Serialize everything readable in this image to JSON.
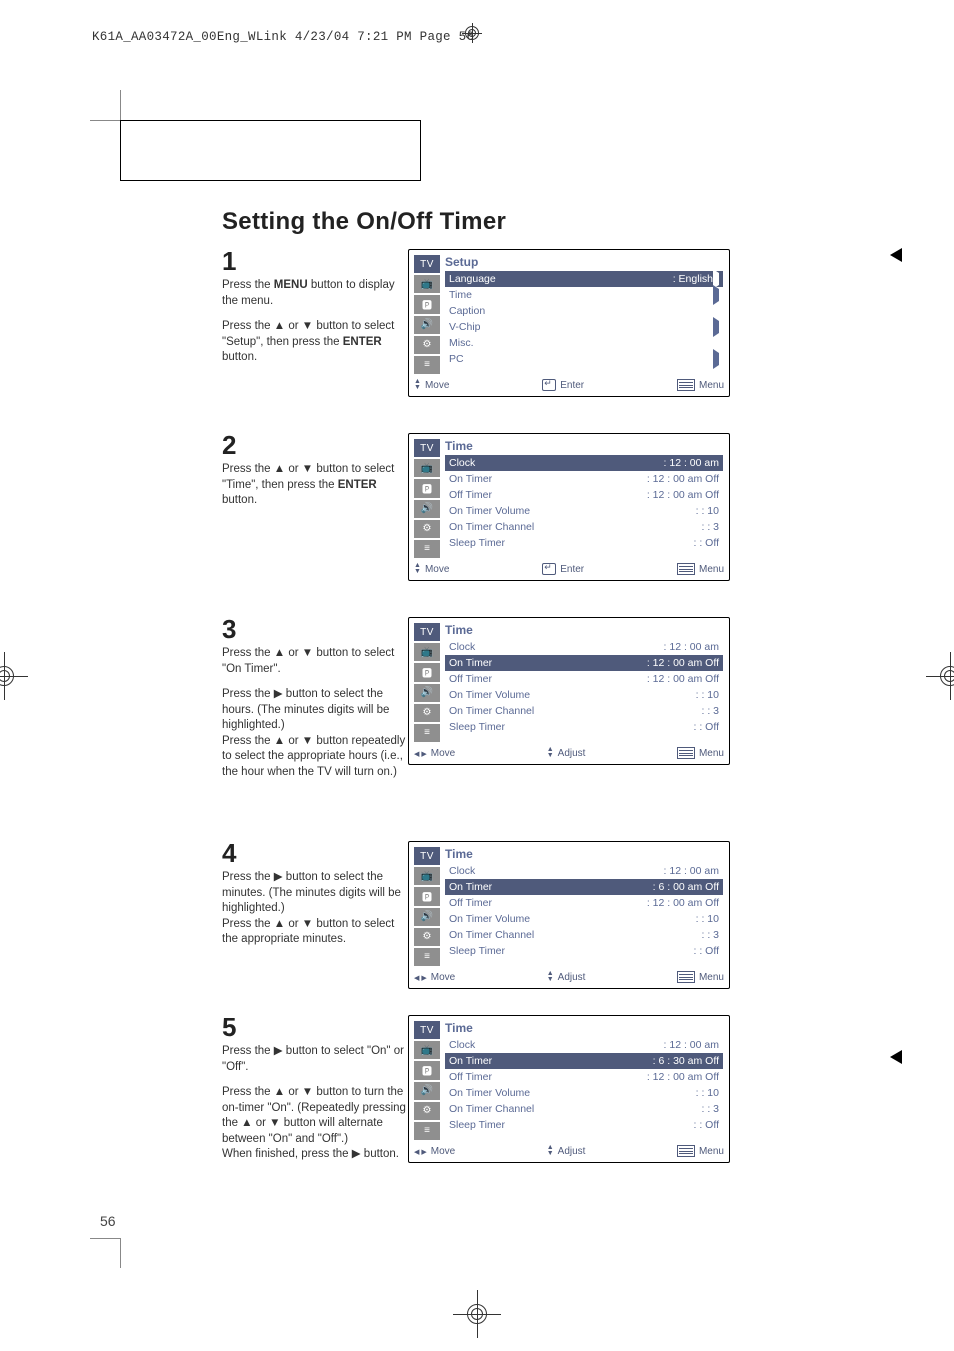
{
  "slug": "K61A_AA03472A_00Eng_WLink  4/23/04  7:21 PM  Page 56",
  "section_title": "Setting the On/Off Timer",
  "page_number": "56",
  "glyph": {
    "up": "▲",
    "down": "▼",
    "right": "▶"
  },
  "steps": [
    {
      "num": "1",
      "paras": [
        "Press the <b>MENU</b> button to display the menu.",
        "Press the ▲ or ▼ button to select \"Setup\", then press the <b>ENTER</b> button."
      ]
    },
    {
      "num": "2",
      "paras": [
        "Press the ▲ or ▼ button to select \"Time\", then press the <b>ENTER</b> button."
      ]
    },
    {
      "num": "3",
      "paras": [
        "Press the ▲ or ▼ button to select \"On Timer\".",
        "Press the ▶ button to select the hours. (The minutes digits will be highlighted.)<br>Press the ▲ or ▼ button repeatedly to select the appropriate hours (i.e., the hour when the TV will turn on.)"
      ]
    },
    {
      "num": "4",
      "paras": [
        "Press the ▶ button to select the minutes. (The minutes digits will be highlighted.)<br>Press the ▲ or ▼ button to select the appropriate minutes."
      ]
    },
    {
      "num": "5",
      "paras": [
        "Press the ▶ button to select \"On\" or \"Off\".",
        "Press the ▲ or ▼ button to turn the on-timer \"On\". (Repeatedly pressing the ▲ or ▼ button will alternate between \"On\" and \"Off\".)<br>When finished, press the ▶ button."
      ]
    }
  ],
  "osd_icons_label": "TV",
  "osd": [
    {
      "title": "Setup",
      "rows": [
        {
          "label": "Language",
          "value": "English",
          "sel": true,
          "arrow": true,
          "arrowOnLeft": true
        },
        {
          "label": "Time",
          "value": "",
          "sel": false,
          "arrow": true
        },
        {
          "label": "Caption",
          "value": "",
          "sel": false,
          "arrow": false
        },
        {
          "label": "V-Chip",
          "value": "",
          "sel": false,
          "arrow": true
        },
        {
          "label": "Misc.",
          "value": "",
          "sel": false,
          "arrow": false
        },
        {
          "label": "PC",
          "value": "",
          "sel": false,
          "arrow": true
        }
      ],
      "footer": {
        "left": "Move",
        "mid": "Enter",
        "right": "Menu",
        "nav": "updown"
      }
    },
    {
      "title": "Time",
      "rows": [
        {
          "label": "Clock",
          "value": "12 : 00 am",
          "sel": true
        },
        {
          "label": "On Timer",
          "value": "12 : 00 am Off"
        },
        {
          "label": "Off Timer",
          "value": "12 : 00 am Off"
        },
        {
          "label": "On Timer Volume",
          "value": ": 10"
        },
        {
          "label": "On Timer Channel",
          "value": ":   3"
        },
        {
          "label": "Sleep Timer",
          "value": ": Off"
        }
      ],
      "footer": {
        "left": "Move",
        "mid": "Enter",
        "right": "Menu",
        "nav": "updown"
      }
    },
    {
      "title": "Time",
      "rows": [
        {
          "label": "Clock",
          "value": "12 : 00 am"
        },
        {
          "label": "On Timer",
          "value": "12 : 00 am Off",
          "sel": true
        },
        {
          "label": "Off Timer",
          "value": "12 : 00 am Off"
        },
        {
          "label": "On Timer Volume",
          "value": ": 10"
        },
        {
          "label": "On Timer Channel",
          "value": ":   3"
        },
        {
          "label": "Sleep Timer",
          "value": ": Off"
        }
      ],
      "footer": {
        "left": "Move",
        "mid": "Adjust",
        "right": "Menu",
        "nav": "lr"
      }
    },
    {
      "title": "Time",
      "rows": [
        {
          "label": "Clock",
          "value": "12 : 00 am"
        },
        {
          "label": "On Timer",
          "value": "6 : 00 am Off",
          "sel": true
        },
        {
          "label": "Off Timer",
          "value": "12 : 00 am Off"
        },
        {
          "label": "On Timer Volume",
          "value": ": 10"
        },
        {
          "label": "On Timer Channel",
          "value": ":   3"
        },
        {
          "label": "Sleep Timer",
          "value": ": Off"
        }
      ],
      "footer": {
        "left": "Move",
        "mid": "Adjust",
        "right": "Menu",
        "nav": "lr"
      }
    },
    {
      "title": "Time",
      "rows": [
        {
          "label": "Clock",
          "value": "12 : 00 am"
        },
        {
          "label": "On Timer",
          "value": "6 : 30 am Off",
          "sel": true
        },
        {
          "label": "Off Timer",
          "value": "12 : 00 am Off"
        },
        {
          "label": "On Timer Volume",
          "value": ": 10"
        },
        {
          "label": "On Timer Channel",
          "value": ":   3"
        },
        {
          "label": "Sleep Timer",
          "value": ": Off"
        }
      ],
      "footer": {
        "left": "Move",
        "mid": "Adjust",
        "right": "Menu",
        "nav": "lr"
      }
    }
  ]
}
